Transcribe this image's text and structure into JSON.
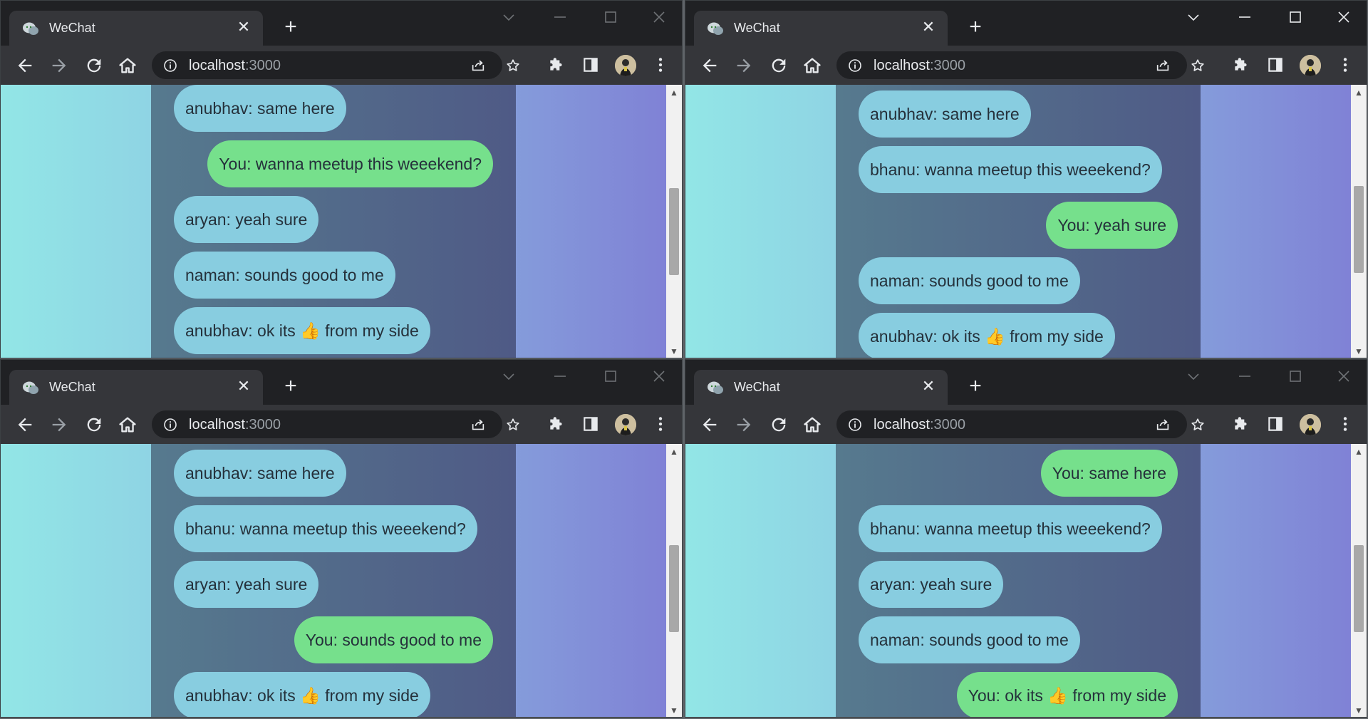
{
  "tab_title": "WeChat",
  "url_host": "localhost",
  "url_port": ":3000",
  "colors": {
    "other_bubble": "#88cde0",
    "own_bubble": "#76e08c",
    "panel_left": "#567a8e",
    "panel_right": "#4f5a86"
  },
  "icons": {
    "back": "arrow-left-icon",
    "forward": "arrow-right-icon",
    "reload": "reload-icon",
    "home": "home-icon",
    "info": "info-icon",
    "share": "share-icon",
    "bookmark": "star-icon",
    "extensions": "puzzle-icon",
    "side_panel": "side-panel-icon",
    "menu": "kebab-menu-icon"
  },
  "windows": [
    {
      "active": false,
      "messages": [
        {
          "text": "anubhav: same here",
          "mine": false
        },
        {
          "text": "You: wanna meetup this weeekend?",
          "mine": true
        },
        {
          "text": "aryan: yeah sure",
          "mine": false
        },
        {
          "text": "naman: sounds good to me",
          "mine": false
        },
        {
          "text_before": "anubhav: ok its ",
          "emoji": "👍",
          "text_after": " from my side",
          "mine": false
        }
      ]
    },
    {
      "active": true,
      "messages": [
        {
          "text": "anubhav: same here",
          "mine": false
        },
        {
          "text": "bhanu: wanna meetup this weeekend?",
          "mine": false
        },
        {
          "text": "You: yeah sure",
          "mine": true
        },
        {
          "text": "naman: sounds good to me",
          "mine": false
        },
        {
          "text_before": "anubhav: ok its ",
          "emoji": "👍",
          "text_after": " from my side",
          "mine": false
        }
      ]
    },
    {
      "active": false,
      "messages": [
        {
          "text": "anubhav: same here",
          "mine": false
        },
        {
          "text": "bhanu: wanna meetup this weeekend?",
          "mine": false
        },
        {
          "text": "aryan: yeah sure",
          "mine": false
        },
        {
          "text": "You: sounds good to me",
          "mine": true
        },
        {
          "text_before": "anubhav: ok its ",
          "emoji": "👍",
          "text_after": " from my side",
          "mine": false
        }
      ]
    },
    {
      "active": false,
      "messages": [
        {
          "text": "You: same here",
          "mine": true
        },
        {
          "text": "bhanu: wanna meetup this weeekend?",
          "mine": false
        },
        {
          "text": "aryan: yeah sure",
          "mine": false
        },
        {
          "text": "naman: sounds good to me",
          "mine": false
        },
        {
          "text_before": "You: ok its ",
          "emoji": "👍",
          "text_after": " from my side",
          "mine": true
        }
      ]
    }
  ]
}
